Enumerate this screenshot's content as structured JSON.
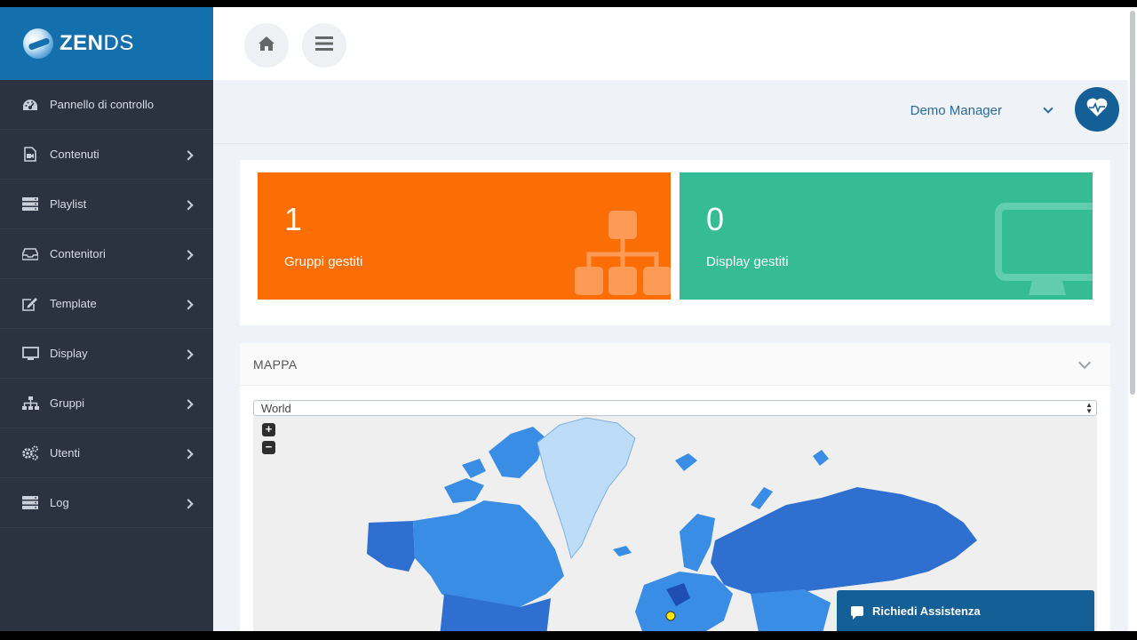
{
  "brand": {
    "name_bold": "ZEN",
    "name_light": "DS"
  },
  "sidebar": {
    "items": [
      {
        "label": "Pannello di controllo",
        "icon": "dashboard-icon",
        "has_submenu": false
      },
      {
        "label": "Contenuti",
        "icon": "file-video-icon",
        "has_submenu": true
      },
      {
        "label": "Playlist",
        "icon": "server-list-icon",
        "has_submenu": true
      },
      {
        "label": "Contenitori",
        "icon": "inbox-icon",
        "has_submenu": true
      },
      {
        "label": "Template",
        "icon": "edit-icon",
        "has_submenu": true
      },
      {
        "label": "Display",
        "icon": "monitor-icon",
        "has_submenu": true
      },
      {
        "label": "Gruppi",
        "icon": "sitemap-icon",
        "has_submenu": true
      },
      {
        "label": "Utenti",
        "icon": "cogs-icon",
        "has_submenu": true
      },
      {
        "label": "Log",
        "icon": "server-list-icon",
        "has_submenu": true
      }
    ]
  },
  "topbar": {
    "home_icon": "home-icon",
    "menu_icon": "hamburger-icon"
  },
  "user": {
    "name": "Demo Manager",
    "avatar_icon": "heartbeat-icon"
  },
  "stats": [
    {
      "number": "1",
      "label": "Gruppi gestiti",
      "color": "#fb6d05",
      "icon": "sitemap-icon"
    },
    {
      "number": "0",
      "label": "Display gestiti",
      "color": "#36bc95",
      "icon": "monitor-icon"
    }
  ],
  "map": {
    "title": "MAPPA",
    "region_selected": "World",
    "zoom_in": "+",
    "zoom_out": "−"
  },
  "assist": {
    "label": "Richiedi Assistenza"
  },
  "colors": {
    "sidebar_bg": "#2b3341",
    "brand_bg": "#146fad",
    "accent": "#155f97",
    "map_land_dark": "#2f6fd0",
    "map_land_mid": "#3a8de4",
    "map_land_light": "#bcdcf7"
  }
}
